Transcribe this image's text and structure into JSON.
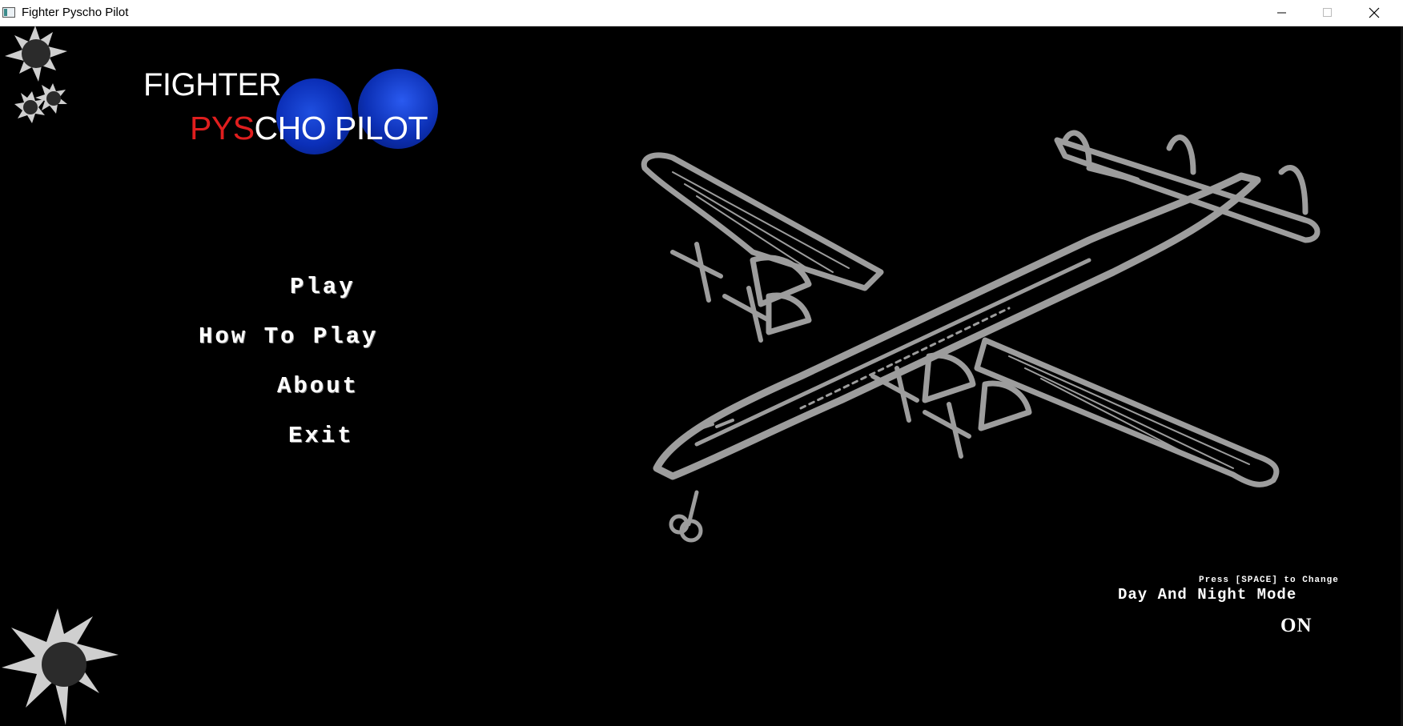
{
  "window": {
    "title": "Fighter Pyscho Pilot",
    "icon": "app-window-icon",
    "controls": [
      "minimize-icon",
      "maximize-icon",
      "close-icon"
    ]
  },
  "logo": {
    "line1": "FIGHTER",
    "line2_red": "PYS",
    "line2_white": "CHO PILOT",
    "colors": {
      "red": "#e01e1e",
      "blue": "#0c30b5"
    }
  },
  "menu": {
    "play": "Play",
    "how_to_play": "How To Play",
    "about": "About",
    "exit": "Exit"
  },
  "day_night": {
    "hint": "Press [SPACE] to Change",
    "label": "Day And Night Mode",
    "value": "ON"
  },
  "decorations": [
    "bullet-hole-icon",
    "airplane-illustration"
  ]
}
